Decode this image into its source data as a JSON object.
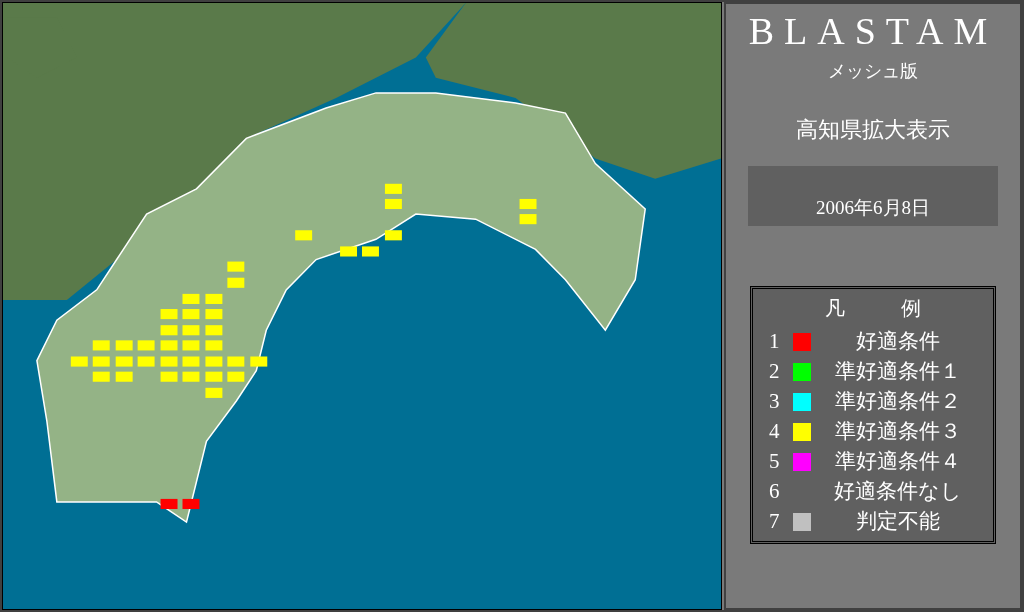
{
  "header": {
    "title": "BLASTAM",
    "subtitle": "メッシュ版",
    "view": "高知県拡大表示"
  },
  "date": "2006年6月8日",
  "legend": {
    "title_left": "凡",
    "title_right": "例",
    "items": [
      {
        "number": "1",
        "label": "好適条件",
        "color": "#ff0000"
      },
      {
        "number": "2",
        "label": "準好適条件１",
        "color": "#00ff00"
      },
      {
        "number": "3",
        "label": "準好適条件２",
        "color": "#00ffff"
      },
      {
        "number": "4",
        "label": "準好適条件３",
        "color": "#ffff00"
      },
      {
        "number": "5",
        "label": "準好適条件４",
        "color": "#ff00ff"
      },
      {
        "number": "6",
        "label": "好適条件なし"
      },
      {
        "number": "7",
        "label": "判定不能",
        "color": "#c0c0c0"
      }
    ]
  }
}
